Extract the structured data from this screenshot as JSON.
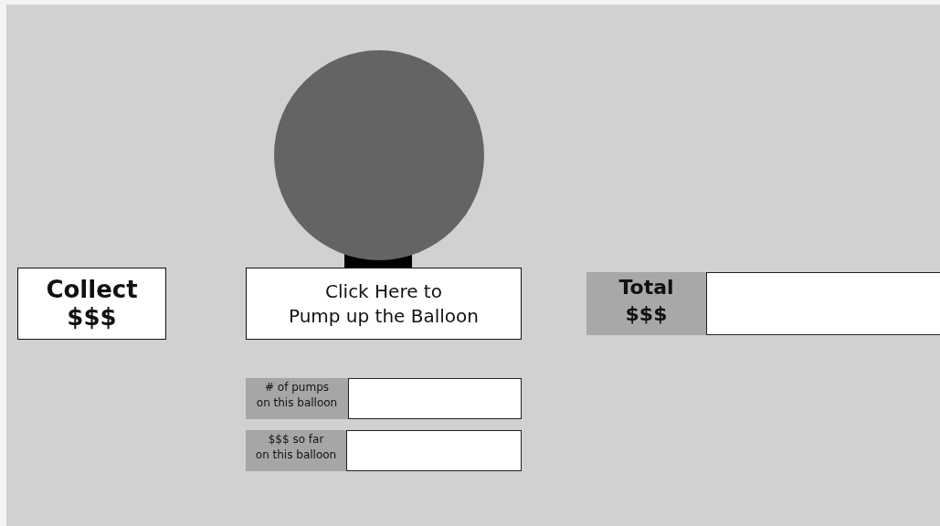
{
  "collect_button": {
    "label_lines": [
      "Collect",
      "$$$"
    ]
  },
  "pump_button": {
    "label_lines": [
      "Click Here to",
      "Pump up the Balloon"
    ]
  },
  "total": {
    "label_lines": [
      "Total",
      "$$$"
    ]
  },
  "balloon_stats": [
    {
      "label_lines": [
        "# of pumps",
        "on this balloon"
      ]
    },
    {
      "label_lines": [
        "$$$ so far",
        "on this balloon"
      ]
    }
  ]
}
